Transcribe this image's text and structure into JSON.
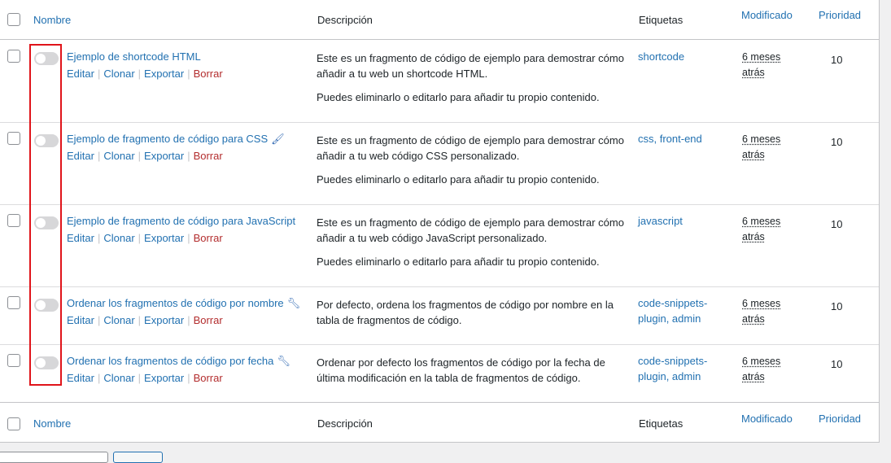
{
  "columns": {
    "name": "Nombre",
    "description": "Descripción",
    "tags": "Etiquetas",
    "modified": "Modificado",
    "priority": "Prioridad"
  },
  "action_labels": {
    "edit": "Editar",
    "clone": "Clonar",
    "export": "Exportar",
    "delete": "Borrar",
    "separator": "|"
  },
  "rows": [
    {
      "title": "Ejemplo de shortcode HTML",
      "icon": "",
      "desc1": "Este es un fragmento de código de ejemplo para demostrar cómo añadir a tu web un shortcode HTML.",
      "desc2": "Puedes eliminarlo o editarlo para añadir tu propio contenido.",
      "tags": "shortcode",
      "modified": "6 meses atrás",
      "priority": "10",
      "active": false
    },
    {
      "title": "Ejemplo de fragmento de código para CSS",
      "icon": "paintbrush-icon",
      "desc1": "Este es un fragmento de código de ejemplo para demostrar cómo añadir a tu web código CSS personalizado.",
      "desc2": "Puedes eliminarlo o editarlo para añadir tu propio contenido.",
      "tags": "css, front-end",
      "modified": "6 meses atrás",
      "priority": "10",
      "active": false
    },
    {
      "title": "Ejemplo de fragmento de código para JavaScript",
      "icon": "",
      "desc1": "Este es un fragmento de código de ejemplo para demostrar cómo añadir a tu web código JavaScript personalizado.",
      "desc2": "Puedes eliminarlo o editarlo para añadir tu propio contenido.",
      "tags": "javascript",
      "modified": "6 meses atrás",
      "priority": "10",
      "active": false
    },
    {
      "title": "Ordenar los fragmentos de código por nombre",
      "icon": "wrench-icon",
      "desc1": "Por defecto, ordena los fragmentos de código por nombre en la tabla de fragmentos de código.",
      "desc2": "",
      "tags": "code-snippets-plugin, admin",
      "modified": "6 meses atrás",
      "priority": "10",
      "active": false
    },
    {
      "title": "Ordenar los fragmentos de código por fecha",
      "icon": "wrench-icon",
      "desc1": "Ordenar por defecto los fragmentos de código por la fecha de última modificación en la tabla de fragmentos de código.",
      "desc2": "",
      "tags": "code-snippets-plugin, admin",
      "modified": "6 meses atrás",
      "priority": "10",
      "active": false
    }
  ],
  "colors": {
    "link": "#2271b1",
    "delete": "#b32d2e",
    "highlight": "#e0141a",
    "toggle_off": "#d7d7d9"
  }
}
